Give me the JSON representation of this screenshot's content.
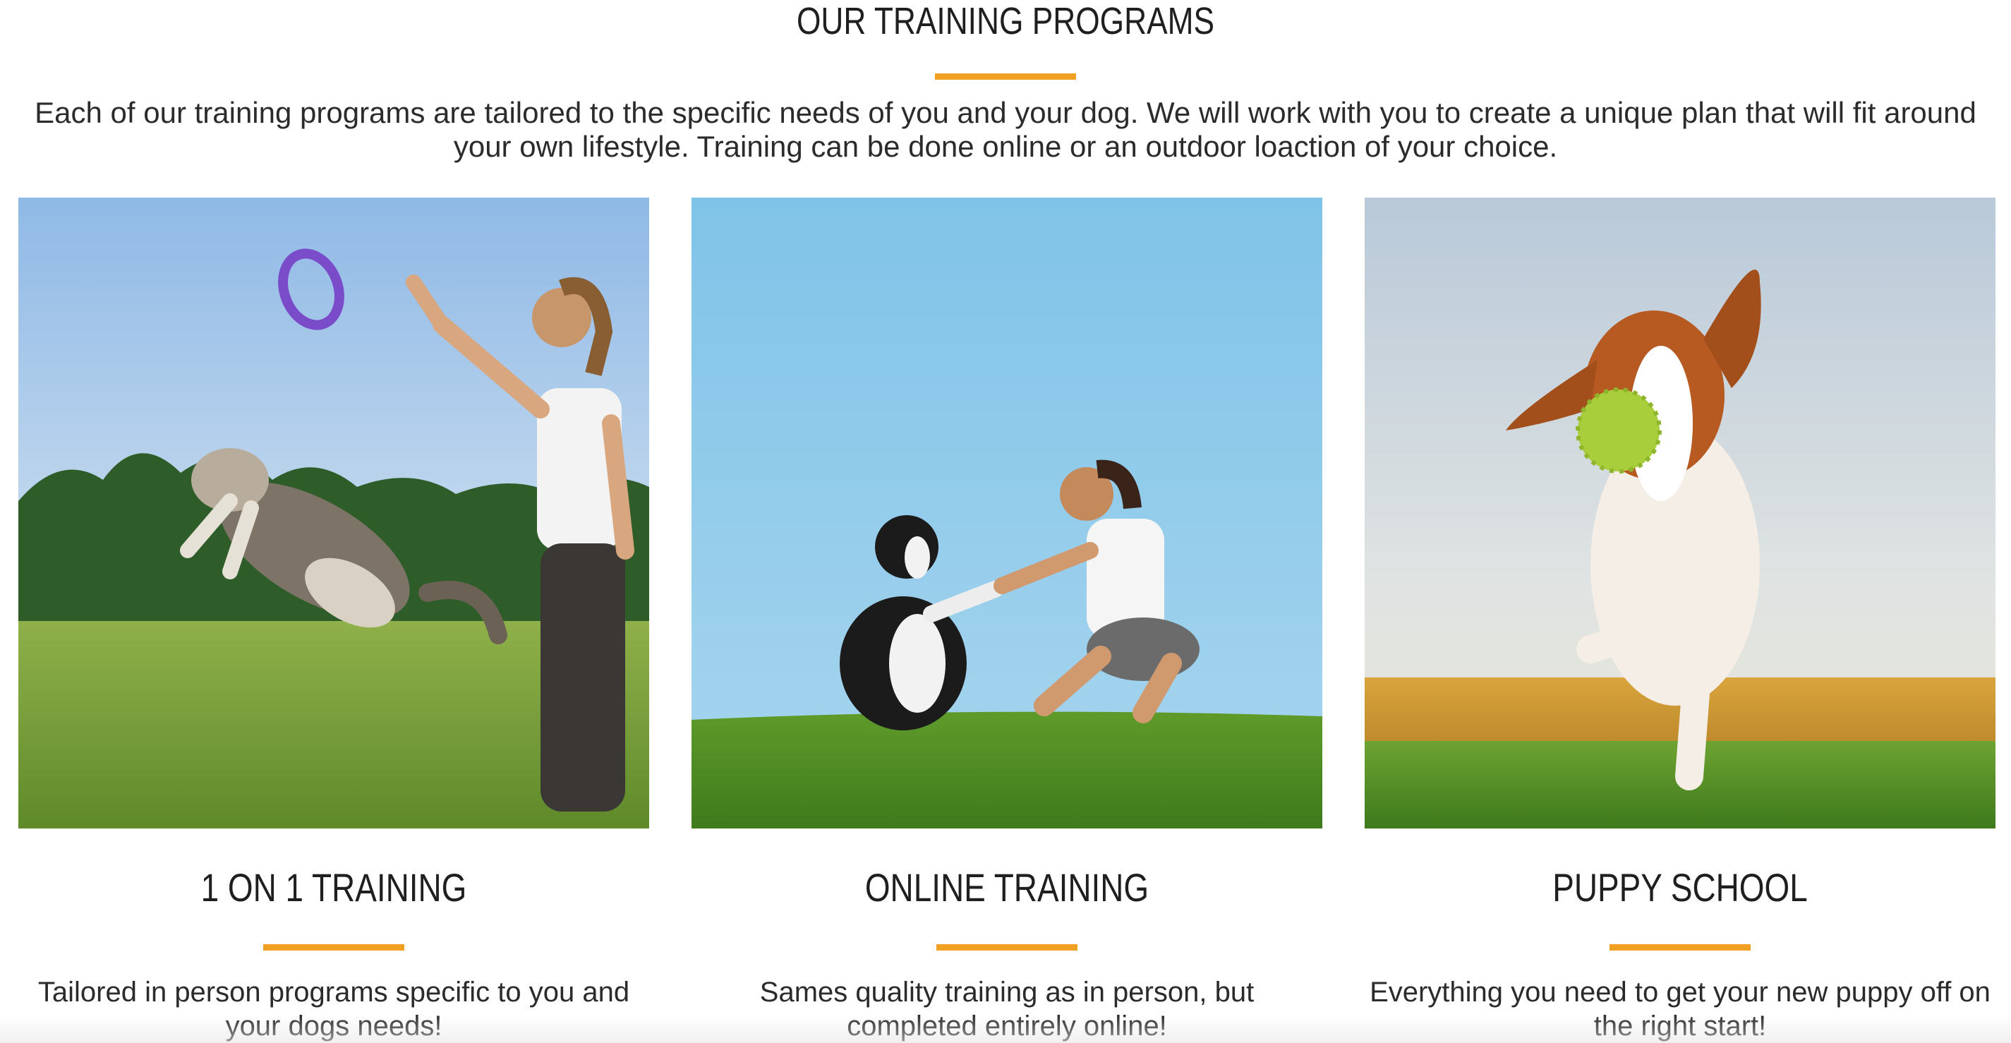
{
  "section": {
    "title": "OUR TRAINING PROGRAMS",
    "intro": "Each of our training programs are tailored to the specific needs of you and your dog. We will work with you to create a unique plan that will fit around your own lifestyle. Training can be done online or an outdoor loaction of your choice."
  },
  "accent_color": "#f0a023",
  "programs": [
    {
      "title": "1 ON 1 TRAINING",
      "description": "Tailored in person programs specific to you and your dogs needs!",
      "image": "woman-and-dog-jumping-for-ring-photo"
    },
    {
      "title": "ONLINE TRAINING",
      "description": "Sames quality training as in person, but completed entirely online!",
      "image": "woman-shaking-paws-with-dog-photo"
    },
    {
      "title": "PUPPY SCHOOL",
      "description": "Everything you need to get your new puppy off on the right start!",
      "image": "beagle-running-with-ball-photo"
    }
  ]
}
